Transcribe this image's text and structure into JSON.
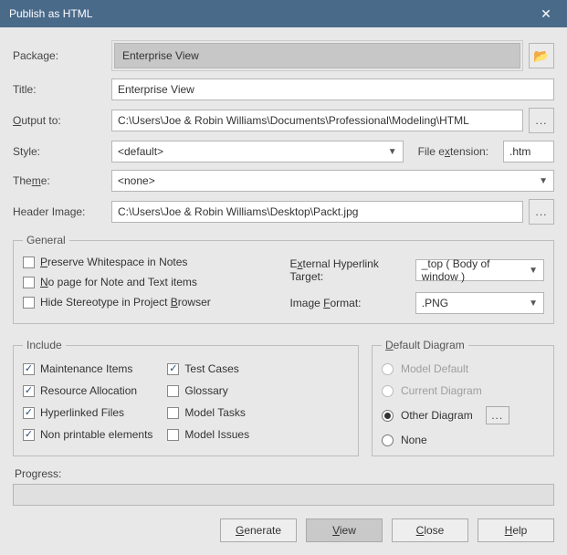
{
  "titlebar": {
    "text": "Publish as HTML"
  },
  "labels": {
    "package": "Package:",
    "title": "Title:",
    "output": "Output to:",
    "style": "Style:",
    "file_ext": "File extension:",
    "theme": "Theme:",
    "header_image": "Header Image:",
    "external_target": "External Hyperlink Target:",
    "image_format": "Image Format:",
    "progress": "Progress:"
  },
  "groups": {
    "general": "General",
    "include": "Include",
    "default_diagram": "Default Diagram"
  },
  "values": {
    "package": "Enterprise View",
    "title": "Enterprise View",
    "output": "C:\\Users\\Joe & Robin Williams\\Documents\\Professional\\Modeling\\HTML",
    "style": "<default>",
    "file_ext": ".htm",
    "theme": "<none>",
    "header_image": "C:\\Users\\Joe & Robin Williams\\Desktop\\Packt.jpg",
    "external_target": "_top  ( Body of window )",
    "image_format": ".PNG"
  },
  "general_checks": {
    "preserve_ws": "Preserve Whitespace in Notes",
    "no_page_note": "No page for Note and Text items",
    "hide_stereo": "Hide Stereotype in Project Browser"
  },
  "include": {
    "maintenance": "Maintenance Items",
    "resource": "Resource Allocation",
    "hyperlinked": "Hyperlinked Files",
    "nonprintable": "Non printable elements",
    "testcases": "Test Cases",
    "glossary": "Glossary",
    "modeltasks": "Model Tasks",
    "modelissues": "Model Issues"
  },
  "default_diagram": {
    "model_default": "Model Default",
    "current": "Current Diagram",
    "other": "Other Diagram",
    "none": "None"
  },
  "buttons": {
    "generate": "Generate",
    "view": "View",
    "close": "Close",
    "help": "Help"
  }
}
